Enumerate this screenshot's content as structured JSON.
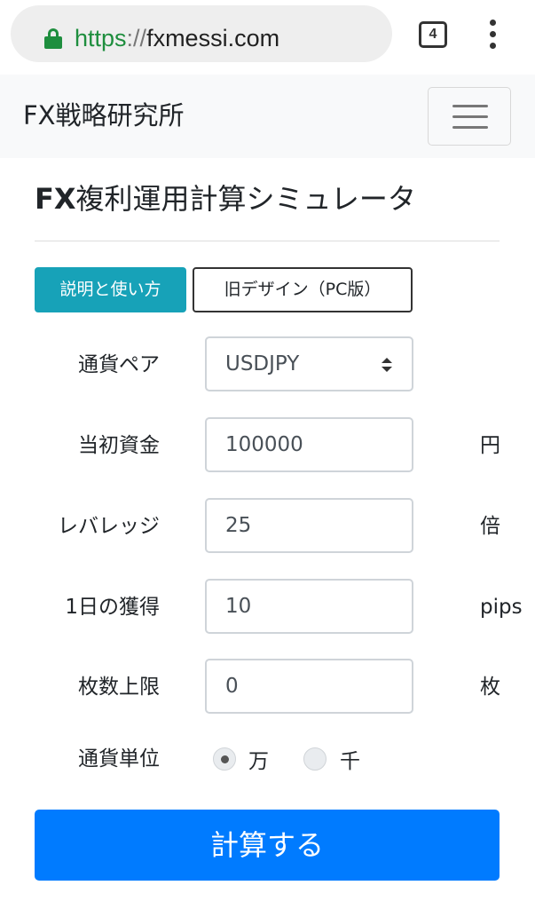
{
  "browser": {
    "url_scheme": "https",
    "url_separator": "://",
    "url_host": "fxmessi.com",
    "tab_count": "4",
    "secure_icon": "lock-icon",
    "menu_icon": "kebab-menu-icon"
  },
  "navbar": {
    "brand": "FX戦略研究所",
    "toggler_icon": "hamburger-icon"
  },
  "page": {
    "title_prefix": "FX",
    "title_rest": "複利運用計算シミュレータ",
    "guide_button": "説明と使い方",
    "old_design_button": "旧デザイン（PC版）"
  },
  "form": {
    "pair_label": "通貨ペア",
    "pair_value": "USDJPY",
    "capital_label": "当初資金",
    "capital_value": "100000",
    "capital_unit": "円",
    "leverage_label": "レバレッジ",
    "leverage_value": "25",
    "leverage_unit": "倍",
    "daily_label": "1日の獲得",
    "daily_value": "10",
    "daily_unit": "pips",
    "lot_label": "枚数上限",
    "lot_value": "0",
    "lot_unit": "枚",
    "currency_unit_label": "通貨単位",
    "unit_option_1": "万",
    "unit_option_2": "千",
    "unit_selected": "万",
    "calc_button": "計算する"
  },
  "colors": {
    "info_button": "#17a2b8",
    "primary_button": "#007bff",
    "secure_green": "#1e8e3e"
  }
}
